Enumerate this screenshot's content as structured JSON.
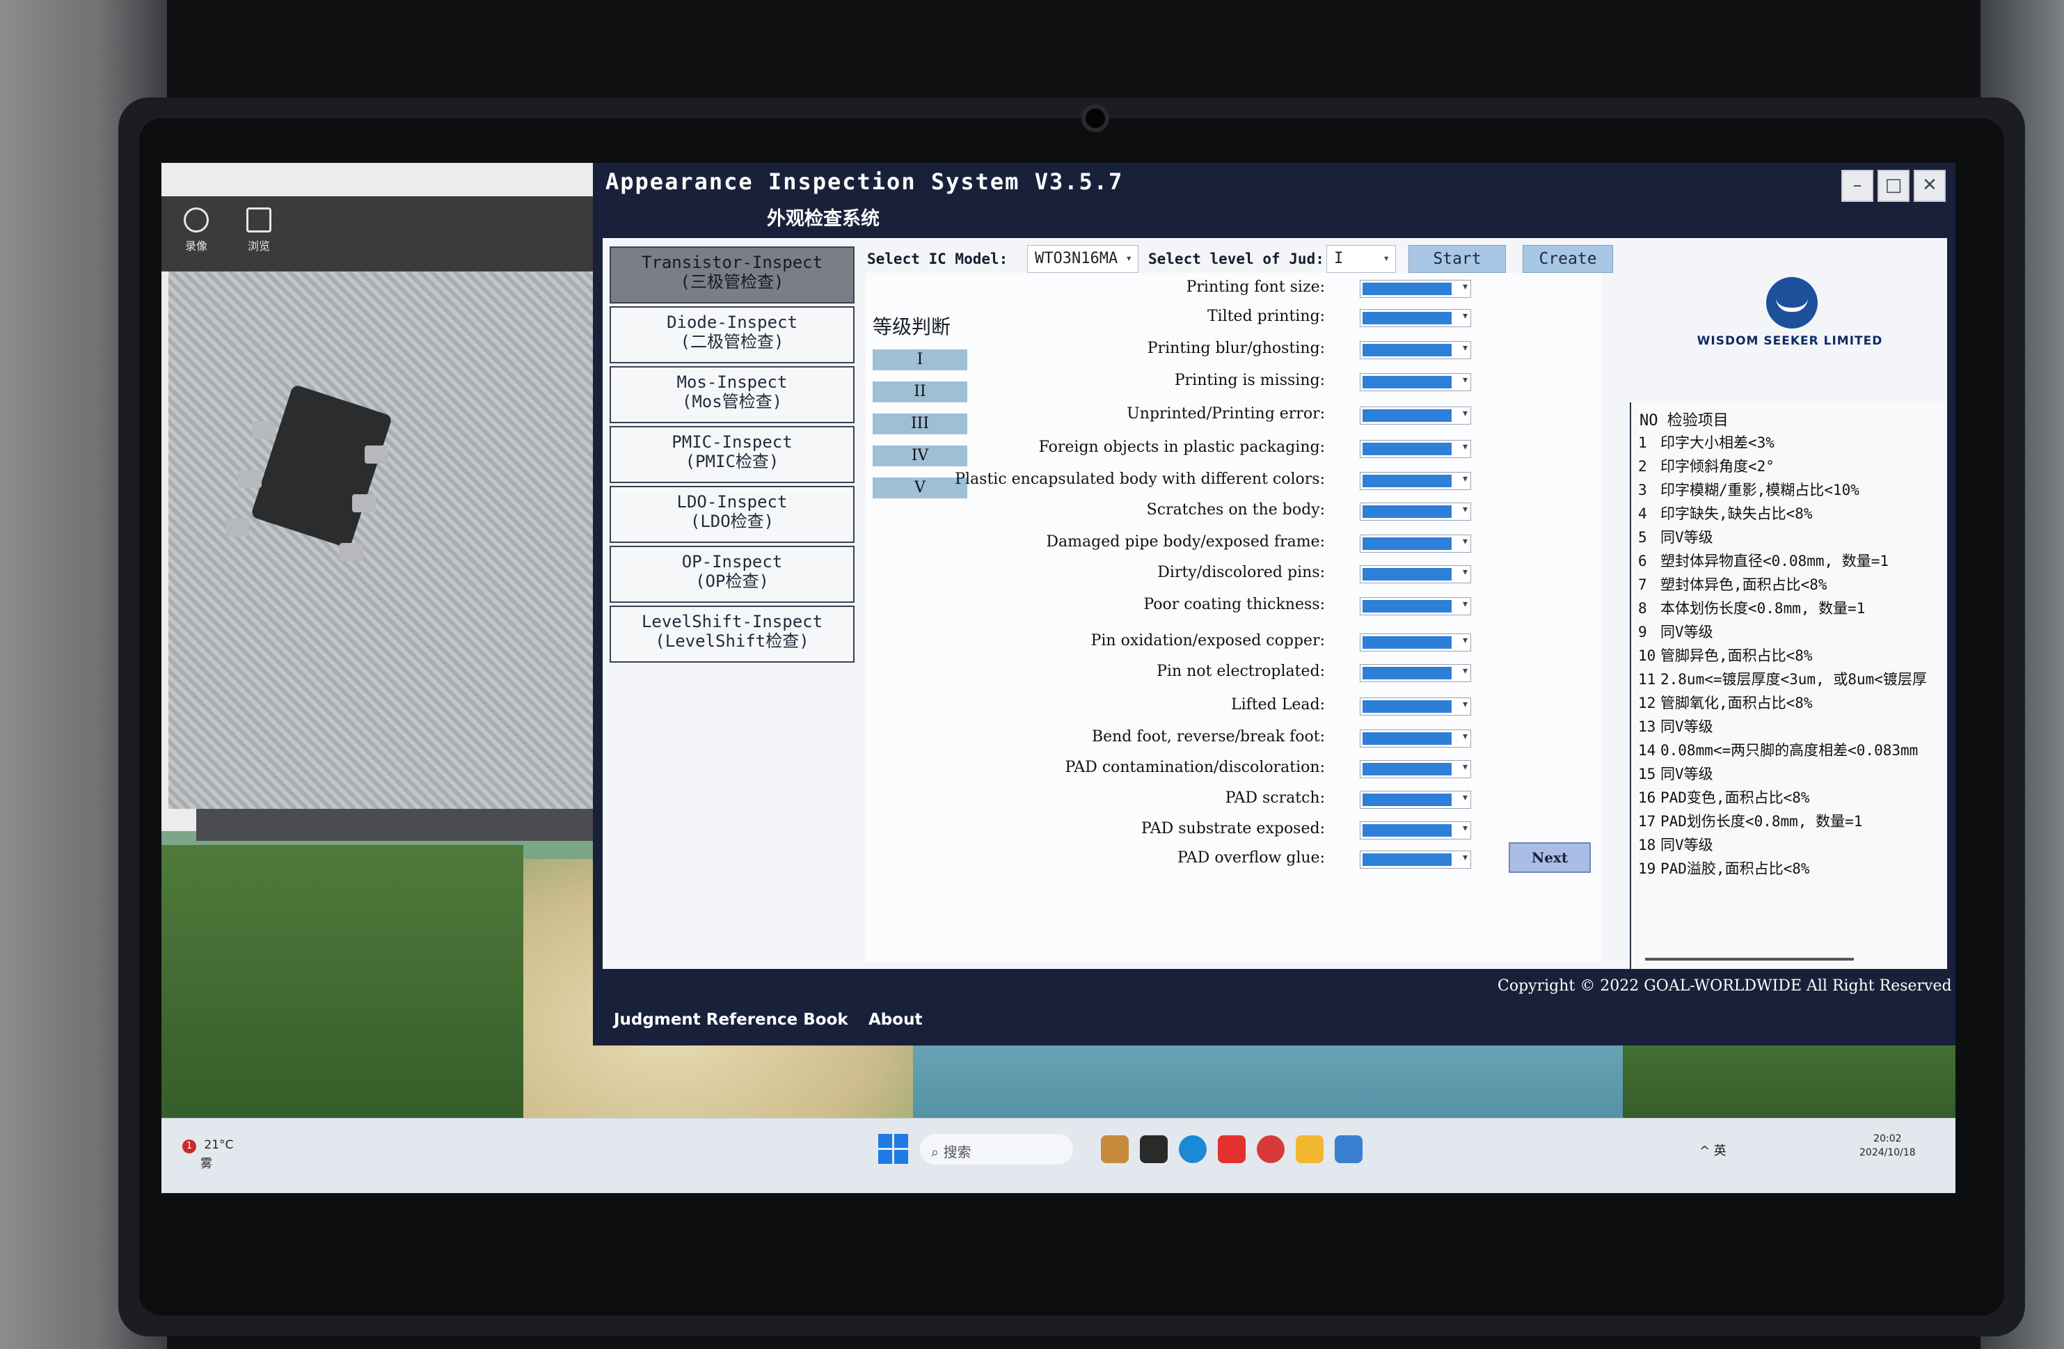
{
  "viewer": {
    "tools": [
      {
        "icon": "record-icon",
        "label": "录像"
      },
      {
        "icon": "browse-icon",
        "label": "浏览"
      }
    ]
  },
  "app": {
    "title": "Appearance Inspection System V3.5.7",
    "subtitle": "外观检查系统",
    "window_controls": {
      "minimize": "–",
      "maximize": "□",
      "close": "✕"
    }
  },
  "nav": {
    "items": [
      {
        "en": "Transistor-Inspect",
        "cn": "(三极管检查)",
        "active": true
      },
      {
        "en": "Diode-Inspect",
        "cn": "(二极管检查)",
        "active": false
      },
      {
        "en": "Mos-Inspect",
        "cn": "(Mos管检查)",
        "active": false
      },
      {
        "en": "PMIC-Inspect",
        "cn": "(PMIC检查)",
        "active": false
      },
      {
        "en": "LDO-Inspect",
        "cn": "(LDO检查)",
        "active": false
      },
      {
        "en": "OP-Inspect",
        "cn": "(OP检查)",
        "active": false
      },
      {
        "en": "LevelShift-Inspect",
        "cn": "(LevelShift检查)",
        "active": false
      }
    ]
  },
  "toolbar": {
    "model_label": "Select IC Model:",
    "model_value": "WTO3N16MA",
    "level_label": "Select level of Jud:",
    "level_value": "I",
    "start_label": "Start",
    "create_label": "Create"
  },
  "grading": {
    "title": "等级判断",
    "levels": [
      "I",
      "II",
      "III",
      "IV",
      "V"
    ]
  },
  "inspection_items": [
    "Printing font size:",
    "Tilted printing:",
    "Printing blur/ghosting:",
    "Printing is missing:",
    "Unprinted/Printing error:",
    "Foreign objects in plastic packaging:",
    "Plastic encapsulated body with different colors:",
    "Scratches on the body:",
    "Damaged pipe body/exposed frame:",
    "Dirty/discolored pins:",
    "Poor coating thickness:",
    "Pin oxidation/exposed copper:",
    "Pin not electroplated:",
    "Lifted Lead:",
    "Bend foot, reverse/break foot:",
    "PAD contamination/discoloration:",
    "PAD scratch:",
    "PAD substrate exposed:",
    "PAD overflow glue:"
  ],
  "next_label": "Next",
  "logo": {
    "text": "WISDOM SEEKER LIMITED"
  },
  "criteria": {
    "header": "NO  检验项目",
    "rows": [
      {
        "no": "1",
        "text": "印字大小相差<3%"
      },
      {
        "no": "2",
        "text": "印字倾斜角度<2°"
      },
      {
        "no": "3",
        "text": "印字模糊/重影,模糊占比<10%"
      },
      {
        "no": "4",
        "text": "印字缺失,缺失占比<8%"
      },
      {
        "no": "5",
        "text": "同V等级"
      },
      {
        "no": "6",
        "text": "塑封体异物直径<0.08mm, 数量=1"
      },
      {
        "no": "7",
        "text": "塑封体异色,面积占比<8%"
      },
      {
        "no": "8",
        "text": "本体划伤长度<0.8mm, 数量=1"
      },
      {
        "no": "9",
        "text": "同V等级"
      },
      {
        "no": "10",
        "text": "管脚异色,面积占比<8%"
      },
      {
        "no": "11",
        "text": "2.8um<=镀层厚度<3um, 或8um<镀层厚"
      },
      {
        "no": "12",
        "text": "管脚氧化,面积占比<8%"
      },
      {
        "no": "13",
        "text": "同V等级"
      },
      {
        "no": "14",
        "text": "0.08mm<=两只脚的高度相差<0.083mm"
      },
      {
        "no": "15",
        "text": "同V等级"
      },
      {
        "no": "16",
        "text": "PAD变色,面积占比<8%"
      },
      {
        "no": "17",
        "text": "PAD划伤长度<0.8mm, 数量=1"
      },
      {
        "no": "18",
        "text": "同V等级"
      },
      {
        "no": "19",
        "text": "PAD溢胶,面积占比<8%"
      }
    ]
  },
  "footer": {
    "reference_label": "Judgment Reference Book",
    "about_label": "About",
    "copyright": "Copyright © 2022 GOAL-WORLDWIDE All Right Reserved"
  },
  "taskbar": {
    "weather_badge": "1",
    "weather_temp": "21°C",
    "weather_desc": "雾",
    "search_placeholder": "搜索",
    "tray_text": "^   英",
    "time": "20:02",
    "date": "2024/10/18"
  }
}
